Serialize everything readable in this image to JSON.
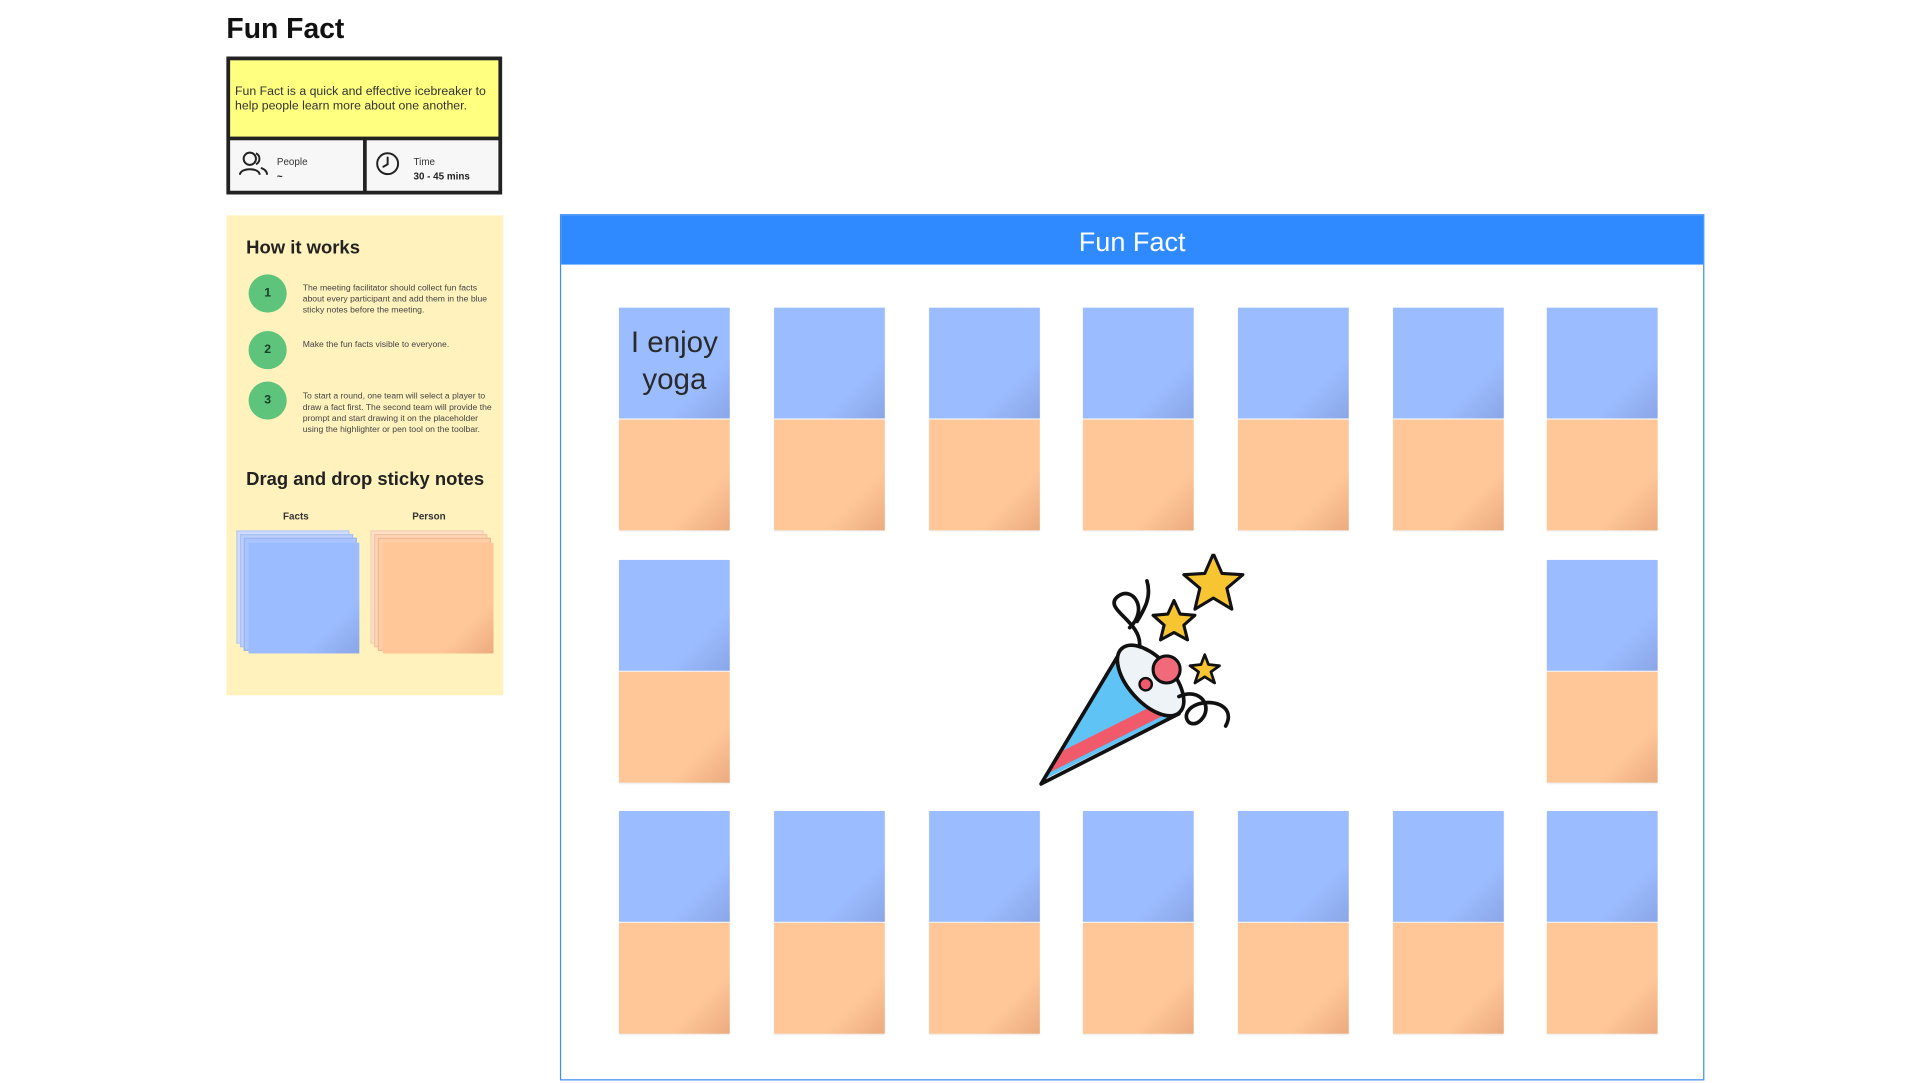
{
  "info": {
    "title": "Fun Fact",
    "description": "Fun Fact is a quick and effective icebreaker to help people learn more about one another.",
    "people_label": "People",
    "people_value": "~",
    "time_label": "Time",
    "time_value": "30 - 45 mins"
  },
  "how_it_works": {
    "title": "How it works",
    "steps": [
      {
        "number": "1",
        "text": "The meeting facilitator should collect fun facts about every participant and add them in the blue sticky notes before the meeting."
      },
      {
        "number": "2",
        "text": "Make the fun facts visible to everyone."
      },
      {
        "number": "3",
        "text": "To start a round, one team will select a player to draw a fact first. The second team will provide the prompt and start drawing it on the placeholder using the highlighter or pen tool on the toolbar."
      }
    ]
  },
  "drag_drop": {
    "title": "Drag and drop sticky notes",
    "facts_label": "Facts",
    "person_label": "Person"
  },
  "board": {
    "title": "Fun Fact",
    "first_note_text": "I enjoy yoga",
    "fact_note_count": 16,
    "filled_fact_note_count": 1
  },
  "colors": {
    "fact_note": "#9bbcff",
    "person_note": "#ffc798",
    "board_header": "#2f8aff",
    "info_note": "#ffff80",
    "panel_bg": "#fff2bd",
    "step_circle": "#5ec47c"
  },
  "icons": {
    "people": "people-icon",
    "time": "clock-icon",
    "decoration": "party-popper-icon"
  }
}
